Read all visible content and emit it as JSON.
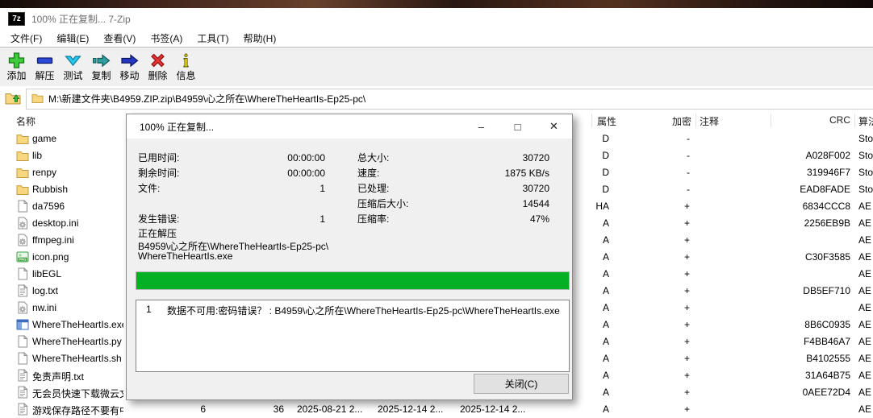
{
  "window": {
    "logo": "7z",
    "title": "100% 正在复制... 7-Zip"
  },
  "menu": {
    "items": [
      "文件(F)",
      "编辑(E)",
      "查看(V)",
      "书签(A)",
      "工具(T)",
      "帮助(H)"
    ]
  },
  "toolbar": {
    "buttons": [
      {
        "label": "添加",
        "icon": "add-icon"
      },
      {
        "label": "解压",
        "icon": "extract-icon"
      },
      {
        "label": "测试",
        "icon": "test-icon"
      },
      {
        "label": "复制",
        "icon": "copy-icon"
      },
      {
        "label": "移动",
        "icon": "move-icon"
      },
      {
        "label": "删除",
        "icon": "delete-icon"
      },
      {
        "label": "信息",
        "icon": "info-icon"
      }
    ]
  },
  "address": {
    "path": "M:\\新建文件夹\\B4959.ZIP.zip\\B4959\\心之所在\\WhereTheHeartIs-Ep25-pc\\"
  },
  "list": {
    "columns": {
      "name": "名称",
      "attr": "属性",
      "encrypted": "加密",
      "comment": "注释",
      "crc": "CRC",
      "method": "算法"
    },
    "rows": [
      {
        "name": "game",
        "icon": "folder",
        "attr": "D",
        "enc": "-",
        "crc": "",
        "method": "Sto"
      },
      {
        "name": "lib",
        "icon": "folder",
        "attr": "D",
        "enc": "-",
        "crc": "A028F002",
        "method": "Sto"
      },
      {
        "name": "renpy",
        "icon": "folder",
        "attr": "D",
        "enc": "-",
        "crc": "319946F7",
        "method": "Sto"
      },
      {
        "name": "Rubbish",
        "icon": "folder",
        "attr": "D",
        "enc": "-",
        "crc": "EAD8FADE",
        "method": "Sto"
      },
      {
        "name": "da7596",
        "icon": "file",
        "attr": "HA",
        "enc": "+",
        "crc": "6834CCC8",
        "method": "AE"
      },
      {
        "name": "desktop.ini",
        "icon": "ini",
        "attr": "A",
        "enc": "+",
        "crc": "2256EB9B",
        "method": "AE"
      },
      {
        "name": "ffmpeg.ini",
        "icon": "ini",
        "attr": "A",
        "enc": "+",
        "crc": "",
        "method": "AE"
      },
      {
        "name": "icon.png",
        "icon": "png",
        "attr": "A",
        "enc": "+",
        "crc": "C30F3585",
        "method": "AE"
      },
      {
        "name": "libEGL",
        "icon": "file",
        "attr": "A",
        "enc": "+",
        "crc": "",
        "method": "AE"
      },
      {
        "name": "log.txt",
        "icon": "txt",
        "attr": "A",
        "enc": "+",
        "crc": "DB5EF710",
        "method": "AE"
      },
      {
        "name": "nw.ini",
        "icon": "ini",
        "attr": "A",
        "enc": "+",
        "crc": "",
        "method": "AE"
      },
      {
        "name": "WhereTheHeartIs.exe",
        "icon": "exe",
        "attr": "A",
        "enc": "+",
        "crc": "8B6C0935",
        "method": "AE"
      },
      {
        "name": "WhereTheHeartIs.py",
        "icon": "file",
        "attr": "A",
        "enc": "+",
        "crc": "F4BB46A7",
        "method": "AE"
      },
      {
        "name": "WhereTheHeartIs.sh",
        "icon": "file",
        "attr": "A",
        "enc": "+",
        "crc": "B4102555",
        "method": "AE"
      },
      {
        "name": "免责声明.txt",
        "icon": "txt",
        "attr": "A",
        "enc": "+",
        "crc": "31A64B75",
        "method": "AE"
      },
      {
        "name": "无会员快速下载微云文...",
        "icon": "txt",
        "attr": "A",
        "enc": "+",
        "crc": "0AEE72D4",
        "method": "AE"
      },
      {
        "name": "游戏保存路径不要有中...",
        "icon": "txt",
        "attr": "A",
        "enc": "+",
        "crc": "",
        "method": "AE",
        "size": "6",
        "packed": "36",
        "modified": "2025-08-21 2...",
        "created": "2025-12-14 2...",
        "accessed": "2025-12-14 2..."
      }
    ]
  },
  "dialog": {
    "title": "100% 正在复制...",
    "controls": [
      {
        "name": "minimize",
        "glyph": "–"
      },
      {
        "name": "maximize",
        "glyph": "□"
      },
      {
        "name": "close",
        "glyph": "✕"
      }
    ],
    "stats_left": [
      {
        "label": "已用时间:",
        "value": "00:00:00"
      },
      {
        "label": "剩余时间:",
        "value": "00:00:00"
      },
      {
        "label": "文件:",
        "value": "1"
      },
      {
        "label": "",
        "value": ""
      },
      {
        "label": "发生错误:",
        "value": "1"
      }
    ],
    "stats_right": [
      {
        "label": "总大小:",
        "value": "30720"
      },
      {
        "label": "速度:",
        "value": "1875 KB/s"
      },
      {
        "label": "已处理:",
        "value": "30720"
      },
      {
        "label": "压缩后大小:",
        "value": "14544"
      },
      {
        "label": "压缩率:",
        "value": "47%"
      }
    ],
    "status": "正在解压",
    "path_line1": "B4959\\心之所在\\WhereTheHeartIs-Ep25-pc\\",
    "path_line2": "WhereTheHeartIs.exe",
    "progress_percent": 100,
    "error_row": {
      "index": "1",
      "message": "数据不可用:密码错误？ : B4959\\心之所在\\WhereTheHeartIs-Ep25-pc\\WhereTheHeartIs.exe"
    },
    "close_label": "关闭(C)"
  },
  "colors": {
    "progress_green": "#06b025",
    "toolbar_bg": "#f0f0f0",
    "dialog_bg": "#f0f0f0"
  }
}
